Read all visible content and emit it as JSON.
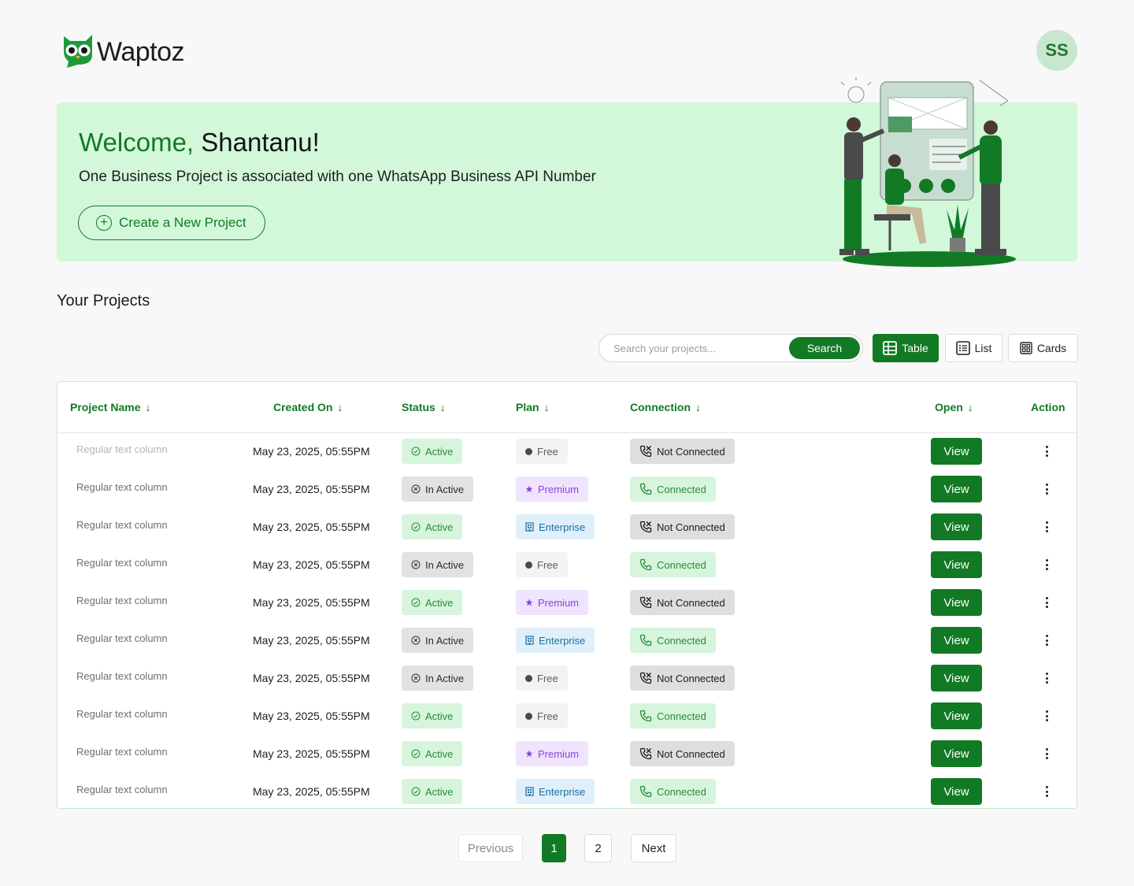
{
  "brand": {
    "name": "Waptoz",
    "accent": "#127a25"
  },
  "user": {
    "initials": "SS"
  },
  "hero": {
    "greeting": "Welcome,",
    "user_name": "Shantanu!",
    "subtitle": "One Business Project is associated with one WhatsApp Business API Number",
    "create_label": "Create a New Project"
  },
  "projects_title": "Your Projects",
  "search": {
    "placeholder": "Search your projects...",
    "button_label": "Search"
  },
  "views": {
    "table": "Table",
    "list": "List",
    "cards": "Cards",
    "active": "table"
  },
  "table": {
    "columns": [
      "Project Name",
      "Created On",
      "Status",
      "Plan",
      "Connection",
      "Open",
      "Action"
    ],
    "rows": [
      {
        "name": "Regular text column",
        "created": "May 23, 2025, 05:55PM",
        "status": "Active",
        "plan": "Free",
        "connection": "Not Connected",
        "open": "View"
      },
      {
        "name": "Regular text column",
        "created": "May 23, 2025, 05:55PM",
        "status": "In Active",
        "plan": "Premium",
        "connection": "Connected",
        "open": "View"
      },
      {
        "name": "Regular text column",
        "created": "May 23, 2025, 05:55PM",
        "status": "Active",
        "plan": "Enterprise",
        "connection": "Not Connected",
        "open": "View"
      },
      {
        "name": "Regular text column",
        "created": "May 23, 2025, 05:55PM",
        "status": "In Active",
        "plan": "Free",
        "connection": "Connected",
        "open": "View"
      },
      {
        "name": "Regular text column",
        "created": "May 23, 2025, 05:55PM",
        "status": "Active",
        "plan": "Premium",
        "connection": "Not Connected",
        "open": "View"
      },
      {
        "name": "Regular text column",
        "created": "May 23, 2025, 05:55PM",
        "status": "In Active",
        "plan": "Enterprise",
        "connection": "Connected",
        "open": "View"
      },
      {
        "name": "Regular text column",
        "created": "May 23, 2025, 05:55PM",
        "status": "In Active",
        "plan": "Free",
        "connection": "Not Connected",
        "open": "View"
      },
      {
        "name": "Regular text column",
        "created": "May 23, 2025, 05:55PM",
        "status": "Active",
        "plan": "Free",
        "connection": "Connected",
        "open": "View"
      },
      {
        "name": "Regular text column",
        "created": "May 23, 2025, 05:55PM",
        "status": "Active",
        "plan": "Premium",
        "connection": "Not Connected",
        "open": "View"
      },
      {
        "name": "Regular text column",
        "created": "May 23, 2025, 05:55PM",
        "status": "Active",
        "plan": "Enterprise",
        "connection": "Connected",
        "open": "View"
      }
    ]
  },
  "pagination": {
    "previous": "Previous",
    "pages": [
      "1",
      "2"
    ],
    "current": "1",
    "next": "Next"
  }
}
